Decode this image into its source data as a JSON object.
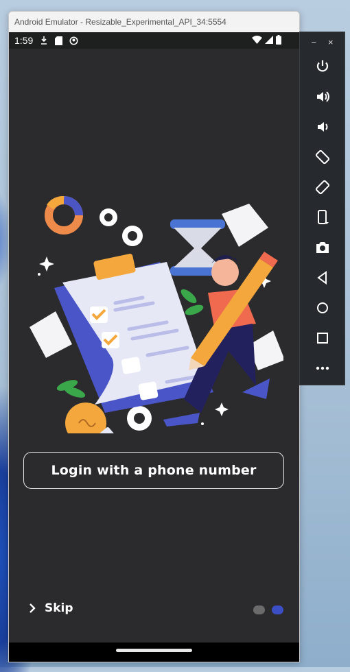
{
  "window": {
    "title": "Android Emulator - Resizable_Experimental_API_34:5554"
  },
  "status_bar": {
    "time": "1:59"
  },
  "screen": {
    "login_button_label": "Login with a phone number",
    "skip_label": "Skip",
    "page_indicator": {
      "count": 2,
      "active_index": 1
    }
  },
  "toolbar": {
    "minimize_label": "−",
    "close_label": "×",
    "items": [
      "power-icon",
      "volume-up-icon",
      "volume-down-icon",
      "rotate-left-icon",
      "rotate-right-icon",
      "fold-device-icon",
      "camera-icon",
      "back-icon",
      "home-icon",
      "overview-icon",
      "more-icon"
    ]
  },
  "colors": {
    "screen_bg": "#2b2b2d",
    "dot_inactive": "#6b6b6b",
    "dot_active": "#3c4ec4",
    "toolbar_bg": "#262a2e"
  }
}
